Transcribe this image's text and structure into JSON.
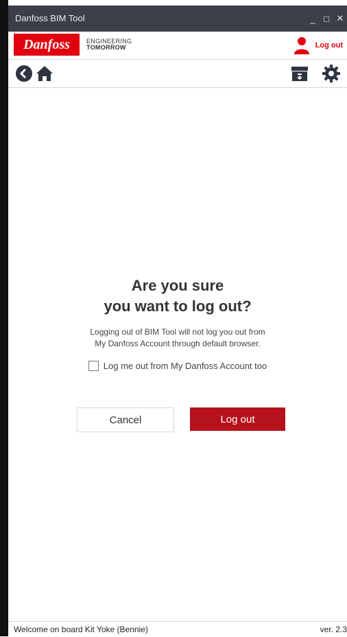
{
  "window": {
    "title": "Danfoss BIM Tool",
    "controls": {
      "minimize": "_",
      "maximize": "□",
      "close": "✕"
    }
  },
  "brand": {
    "logo_text": "Danfoss",
    "tagline_1": "ENGINEERING",
    "tagline_2": "TOMORROW",
    "logout_link": "Log out",
    "accent_color": "#e2000f"
  },
  "navbar": {
    "left_icons": [
      "back-icon",
      "home-icon"
    ],
    "right_icons": [
      "archive-icon",
      "gear-icon"
    ]
  },
  "dialog": {
    "title_line1": "Are you sure",
    "title_line2": "you want to log out?",
    "body_line1": "Logging out of BIM Tool will not log you out from",
    "body_line2": "My Danfoss Account through default browser.",
    "checkbox_label": "Log me out from My Danfoss Account too",
    "checkbox_checked": false,
    "cancel_label": "Cancel",
    "logout_label": "Log out",
    "logout_color": "#b5121b"
  },
  "status": {
    "welcome": "Welcome on board Kit Yoke (Bennie)",
    "version": "ver. 2.3"
  }
}
